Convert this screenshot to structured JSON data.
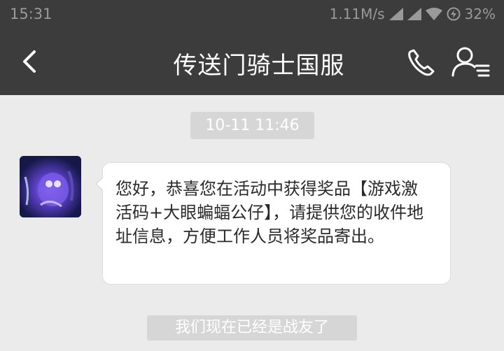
{
  "status_bar": {
    "time": "15:31",
    "network_speed": "1.11M/s",
    "battery": "32%"
  },
  "header": {
    "title": "传送门骑士国服"
  },
  "chat": {
    "timestamp": "10-11 11:46",
    "message": {
      "text": "您好，恭喜您在活动中获得奖品【游戏激活码+大眼蝙蝠公仔】，请提供您的收件地址信息，方便工作人员将奖品寄出。"
    },
    "system_notice": "我们现在已经是战友了"
  },
  "colors": {
    "header_bg": "#3c3c3c",
    "chat_bg": "#ebebeb",
    "bubble_bg": "#ffffff",
    "system_pill_bg": "#d6d6d6"
  }
}
